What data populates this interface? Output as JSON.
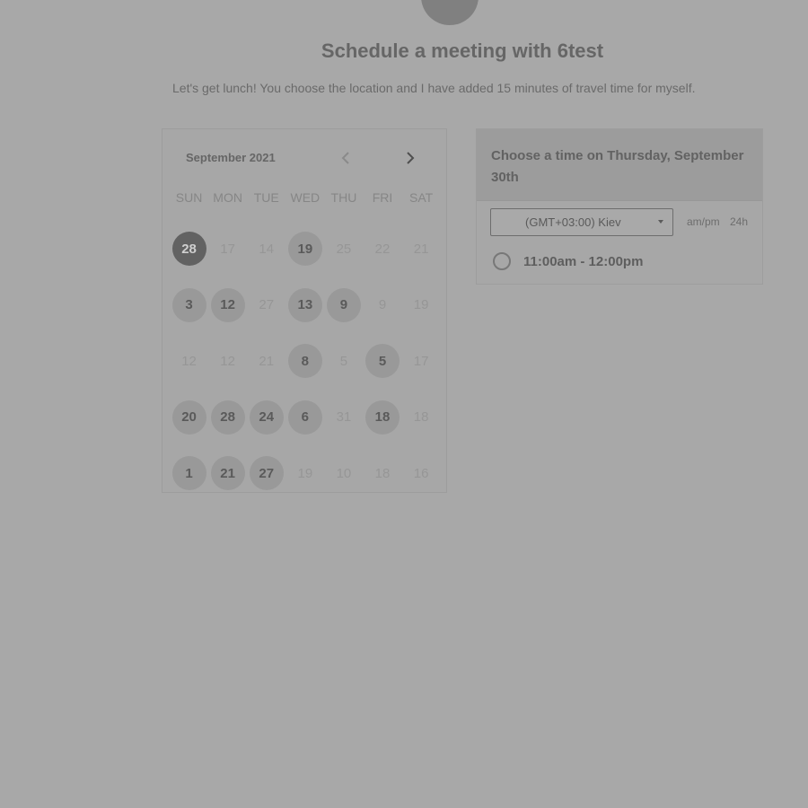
{
  "header": {
    "title": "Schedule a meeting with 6test",
    "subtitle": "Let's get lunch! You choose the location and I have added 15 minutes of travel time for myself."
  },
  "calendar": {
    "month_label": "September 2021",
    "weekdays": [
      "SUN",
      "MON",
      "TUE",
      "WED",
      "THU",
      "FRI",
      "SAT"
    ],
    "days": [
      {
        "label": "28",
        "state": "selected"
      },
      {
        "label": "17",
        "state": "disabled"
      },
      {
        "label": "14",
        "state": "disabled"
      },
      {
        "label": "19",
        "state": "available"
      },
      {
        "label": "25",
        "state": "disabled"
      },
      {
        "label": "22",
        "state": "disabled"
      },
      {
        "label": "21",
        "state": "disabled"
      },
      {
        "label": "3",
        "state": "available"
      },
      {
        "label": "12",
        "state": "available"
      },
      {
        "label": "27",
        "state": "disabled"
      },
      {
        "label": "13",
        "state": "available"
      },
      {
        "label": "9",
        "state": "available"
      },
      {
        "label": "9",
        "state": "disabled"
      },
      {
        "label": "19",
        "state": "disabled"
      },
      {
        "label": "12",
        "state": "disabled"
      },
      {
        "label": "12",
        "state": "disabled"
      },
      {
        "label": "21",
        "state": "disabled"
      },
      {
        "label": "8",
        "state": "available"
      },
      {
        "label": "5",
        "state": "disabled"
      },
      {
        "label": "5",
        "state": "available"
      },
      {
        "label": "17",
        "state": "disabled"
      },
      {
        "label": "20",
        "state": "available"
      },
      {
        "label": "28",
        "state": "available"
      },
      {
        "label": "24",
        "state": "available"
      },
      {
        "label": "6",
        "state": "available"
      },
      {
        "label": "31",
        "state": "disabled"
      },
      {
        "label": "18",
        "state": "available"
      },
      {
        "label": "18",
        "state": "disabled"
      },
      {
        "label": "1",
        "state": "available"
      },
      {
        "label": "21",
        "state": "available"
      },
      {
        "label": "27",
        "state": "available"
      },
      {
        "label": "19",
        "state": "disabled"
      },
      {
        "label": "10",
        "state": "disabled"
      },
      {
        "label": "18",
        "state": "disabled"
      },
      {
        "label": "16",
        "state": "disabled"
      }
    ]
  },
  "time_panel": {
    "heading": "Choose a time on Thursday, September 30th",
    "timezone": "(GMT+03:00) Kiev",
    "format_ampm": "am/pm",
    "format_24h": "24h",
    "slots": [
      {
        "label": "11:00am - 12:00pm"
      }
    ]
  },
  "icons": {
    "prev": "chevron-left-icon",
    "next": "chevron-right-icon",
    "dropdown": "caret-down-icon"
  }
}
